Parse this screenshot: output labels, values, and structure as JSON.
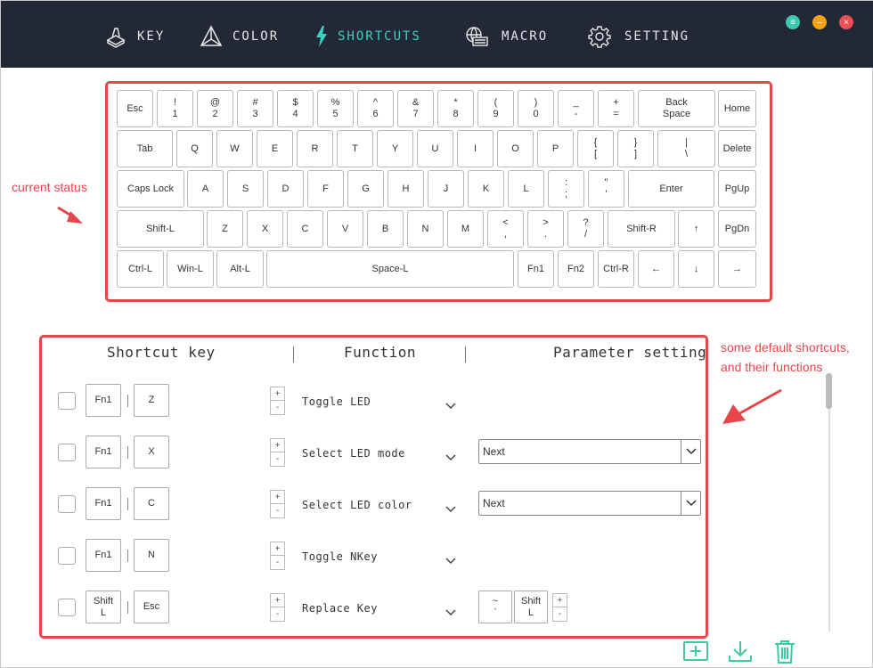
{
  "nav": {
    "items": [
      {
        "label": "KEY",
        "icon": "keycap-icon",
        "active": false
      },
      {
        "label": "COLOR",
        "icon": "color-prism-icon",
        "active": false
      },
      {
        "label": "SHORTCUTS",
        "icon": "lightning-icon",
        "active": true
      },
      {
        "label": "MACRO",
        "icon": "macro-screen-icon",
        "active": false
      },
      {
        "label": "SETTING",
        "icon": "gear-icon",
        "active": false
      }
    ],
    "accent_color": "#40d0c0"
  },
  "window_controls": {
    "menu_icon": "≡",
    "minimize_icon": "–",
    "close_icon": "×"
  },
  "annotations": {
    "current_status": "current status",
    "shortcuts_note_line1": "some default shortcuts,",
    "shortcuts_note_line2": "and their functions",
    "color": "#e8464b"
  },
  "keyboard": {
    "rows": [
      [
        [
          "Esc",
          ""
        ],
        [
          "!",
          "1"
        ],
        [
          "@",
          "2"
        ],
        [
          "#",
          "3"
        ],
        [
          "$",
          "4"
        ],
        [
          "%",
          "5"
        ],
        [
          "^",
          "6"
        ],
        [
          "&",
          "7"
        ],
        [
          "*",
          "8"
        ],
        [
          "(",
          "9"
        ],
        [
          ")",
          "0"
        ],
        [
          "_",
          "-"
        ],
        [
          "+",
          "="
        ],
        [
          "Back",
          "Space"
        ],
        [
          "Home",
          ""
        ]
      ],
      [
        [
          "Tab",
          ""
        ],
        [
          "Q",
          ""
        ],
        [
          "W",
          ""
        ],
        [
          "E",
          ""
        ],
        [
          "R",
          ""
        ],
        [
          "T",
          ""
        ],
        [
          "Y",
          ""
        ],
        [
          "U",
          ""
        ],
        [
          "I",
          ""
        ],
        [
          "O",
          ""
        ],
        [
          "P",
          ""
        ],
        [
          "{",
          "["
        ],
        [
          "}",
          "]"
        ],
        [
          "|",
          "\\"
        ],
        [
          "Delete",
          ""
        ]
      ],
      [
        [
          "Caps Lock",
          ""
        ],
        [
          "A",
          ""
        ],
        [
          "S",
          ""
        ],
        [
          "D",
          ""
        ],
        [
          "F",
          ""
        ],
        [
          "G",
          ""
        ],
        [
          "H",
          ""
        ],
        [
          "J",
          ""
        ],
        [
          "K",
          ""
        ],
        [
          "L",
          ""
        ],
        [
          ":",
          ";"
        ],
        [
          "\"",
          "'"
        ],
        [
          "Enter",
          ""
        ],
        [
          "PgUp",
          ""
        ]
      ],
      [
        [
          "Shift-L",
          ""
        ],
        [
          "Z",
          ""
        ],
        [
          "X",
          ""
        ],
        [
          "C",
          ""
        ],
        [
          "V",
          ""
        ],
        [
          "B",
          ""
        ],
        [
          "N",
          ""
        ],
        [
          "M",
          ""
        ],
        [
          "<",
          ","
        ],
        [
          ">",
          "."
        ],
        [
          "?",
          "/"
        ],
        [
          "Shift-R",
          ""
        ],
        [
          "↑",
          ""
        ],
        [
          "PgDn",
          ""
        ]
      ],
      [
        [
          "Ctrl-L",
          ""
        ],
        [
          "Win-L",
          ""
        ],
        [
          "Alt-L",
          ""
        ],
        [
          "Space-L",
          ""
        ],
        [
          "Fn1",
          ""
        ],
        [
          "Fn2",
          ""
        ],
        [
          "Ctrl-R",
          ""
        ],
        [
          "←",
          ""
        ],
        [
          "↓",
          ""
        ],
        [
          "→",
          ""
        ]
      ]
    ]
  },
  "table": {
    "headers": {
      "shortcut": "Shortcut key",
      "function": "Function",
      "parameter": "Parameter setting"
    },
    "rows": [
      {
        "checked": false,
        "key1": [
          "Fn1",
          ""
        ],
        "key2": [
          "Z",
          ""
        ],
        "function": "Toggle LED",
        "param": null
      },
      {
        "checked": false,
        "key1": [
          "Fn1",
          ""
        ],
        "key2": [
          "X",
          ""
        ],
        "function": "Select LED mode",
        "param": {
          "type": "select",
          "value": "Next"
        }
      },
      {
        "checked": false,
        "key1": [
          "Fn1",
          ""
        ],
        "key2": [
          "C",
          ""
        ],
        "function": "Select LED color",
        "param": {
          "type": "select",
          "value": "Next"
        }
      },
      {
        "checked": false,
        "key1": [
          "Fn1",
          ""
        ],
        "key2": [
          "N",
          ""
        ],
        "function": "Toggle NKey",
        "param": null
      },
      {
        "checked": false,
        "key1": [
          "Shift",
          "L"
        ],
        "key2": [
          "Esc",
          ""
        ],
        "function": "Replace Key",
        "param": {
          "type": "keys",
          "keys": [
            [
              "~",
              "`"
            ],
            [
              "Shift",
              "L"
            ]
          ]
        }
      }
    ],
    "plus": "+",
    "minus": "-"
  },
  "footer": {
    "add_icon": "add-square-icon",
    "download_icon": "download-icon",
    "delete_icon": "trash-icon"
  }
}
